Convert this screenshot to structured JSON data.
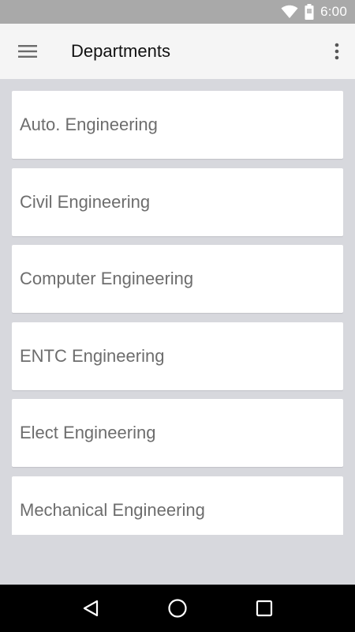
{
  "status_bar": {
    "time": "6:00",
    "icons": [
      "wifi-icon",
      "battery-icon"
    ]
  },
  "app_bar": {
    "title": "Departments",
    "menu_icon": "hamburger-menu-icon",
    "overflow_icon": "more-vertical-icon"
  },
  "departments": [
    {
      "label": "Auto. Engineering"
    },
    {
      "label": "Civil Engineering"
    },
    {
      "label": "Computer Engineering"
    },
    {
      "label": "ENTC Engineering"
    },
    {
      "label": "Elect Engineering"
    },
    {
      "label": "Mechanical Engineering"
    }
  ],
  "nav_bar": {
    "icons": [
      "back-icon",
      "home-icon",
      "recents-icon"
    ]
  },
  "colors": {
    "status_bar": "#a9a9a9",
    "app_bar": "#f5f5f5",
    "background": "#d7d8dd",
    "card": "#ffffff",
    "card_text": "#6d6d6d",
    "nav_bar": "#000000"
  }
}
